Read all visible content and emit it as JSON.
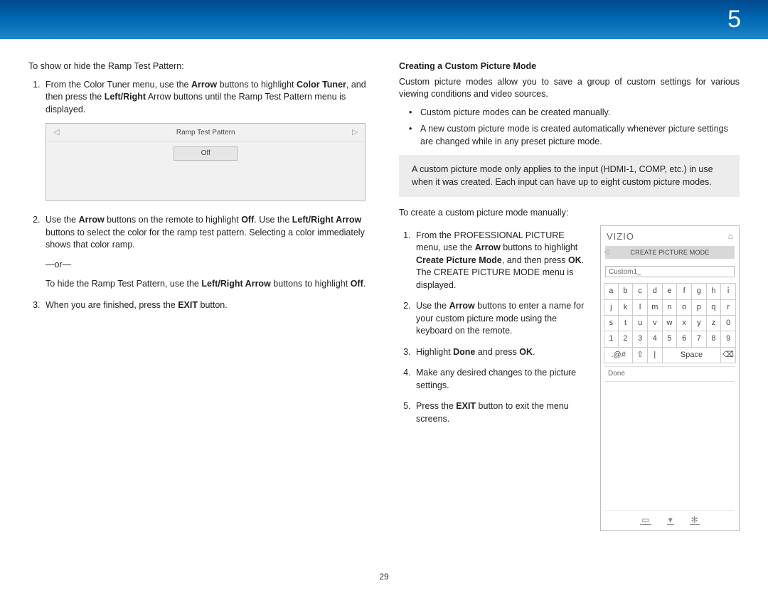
{
  "header": {
    "chapter_number": "5"
  },
  "page_number": "29",
  "left": {
    "intro": "To show or hide the Ramp Test Pattern:",
    "step1_prefix": "From the Color Tuner menu, use the ",
    "b_arrow": "Arrow",
    "step1_mid": " buttons to highlight ",
    "b_color_tuner": "Color Tuner",
    "step1_mid2": ", and then press the ",
    "b_left_right": "Left/Right",
    "step1_suffix": " Arrow buttons until the Ramp Test Pattern menu is displayed.",
    "ramp_title": "Ramp Test Pattern",
    "ramp_value": "Off",
    "step2_prefix": "Use the ",
    "step2_mid": " buttons on the remote to highlight ",
    "b_off": "Off",
    "step2_mid2": ". Use the ",
    "b_lr_arrow": "Left/Right Arrow",
    "step2_suffix": " buttons to select the color for the ramp test pattern. Selecting a color immediately shows that color ramp.",
    "or": "—or—",
    "step2_alt_prefix": "To hide the Ramp Test Pattern, use the ",
    "step2_alt_suffix": " buttons to highlight ",
    "step2_alt_end": ".",
    "step3_prefix": "When you are finished, press the ",
    "b_exit": "EXIT",
    "step3_suffix": " button."
  },
  "right": {
    "title": "Creating a Custom Picture Mode",
    "intro": "Custom picture modes allow you to save a group of custom settings for various viewing conditions and video sources.",
    "bullet1": "Custom picture modes can be created manually.",
    "bullet2": "A new custom picture mode is created automatically whenever picture settings are changed while in any preset picture mode.",
    "note": "A custom picture mode only applies to the input (HDMI-1, COMP, etc.) in use when it was created. Each input can have up to eight custom picture modes.",
    "lead": "To create a custom picture mode manually:",
    "s1_a": "From the PROFESSIONAL PICTURE menu, use the ",
    "s1_b": " buttons to highlight ",
    "s1_bold": "Create Picture Mode",
    "s1_c": ", and then press ",
    "s1_ok": "OK",
    "s1_d": ". The CREATE PICTURE MODE menu is displayed.",
    "s2_a": "Use the ",
    "s2_b": " buttons to enter a name for your custom picture mode using the keyboard on the remote.",
    "s3_a": "Highlight ",
    "s3_done": "Done",
    "s3_b": " and press ",
    "s3_ok": "OK",
    "s3_c": ".",
    "s4": "Make any desired changes to the picture settings.",
    "s5_a": "Press the ",
    "s5_b": " button to exit the menu screens."
  },
  "panel": {
    "brand": "VIZIO",
    "crumb": "CREATE PICTURE MODE",
    "input_value": "Custom1_",
    "rows": [
      [
        "a",
        "b",
        "c",
        "d",
        "e",
        "f",
        "g",
        "h",
        "i"
      ],
      [
        "j",
        "k",
        "l",
        "m",
        "n",
        "o",
        "p",
        "q",
        "r"
      ],
      [
        "s",
        "t",
        "u",
        "v",
        "w",
        "x",
        "y",
        "z",
        "0"
      ],
      [
        "1",
        "2",
        "3",
        "4",
        "5",
        "6",
        "7",
        "8",
        "9"
      ]
    ],
    "sym": ".@#",
    "shift": "⇧",
    "bar": "|",
    "space": "Space",
    "backspace": "⌫",
    "done": "Done",
    "foot1": "▭",
    "foot2": "▾",
    "foot3": "✻",
    "home": "⌂"
  }
}
